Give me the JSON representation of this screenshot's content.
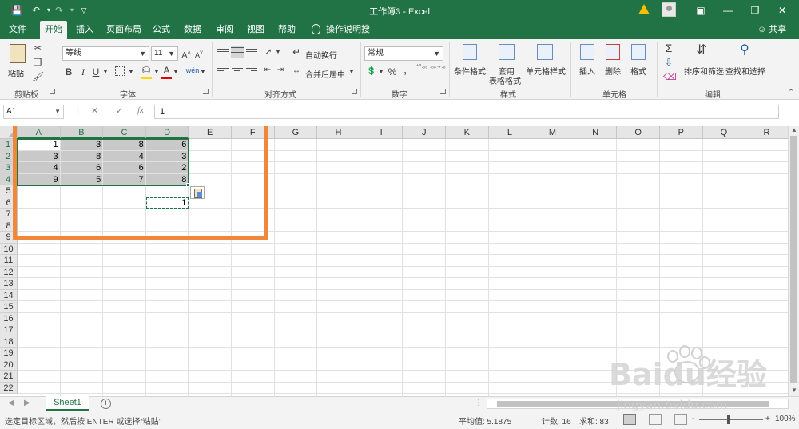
{
  "window": {
    "title": "工作簿3 - Excel",
    "undo_icon": "undo-icon",
    "redo_icon": "redo-icon",
    "save_icon": "save-icon"
  },
  "tabs": [
    {
      "label": "文件"
    },
    {
      "label": "开始",
      "active": true
    },
    {
      "label": "插入"
    },
    {
      "label": "页面布局"
    },
    {
      "label": "公式"
    },
    {
      "label": "数据"
    },
    {
      "label": "审阅"
    },
    {
      "label": "视图"
    },
    {
      "label": "帮助"
    },
    {
      "label": "操作说明搜索"
    }
  ],
  "share_label": "共享",
  "ribbon": {
    "clipboard": {
      "group_label": "剪贴板",
      "paste_label": "粘贴"
    },
    "font": {
      "group_label": "字体",
      "font_name": "等线",
      "font_size": "11",
      "bold": "B",
      "italic": "I",
      "underline": "U",
      "grow": "A",
      "shrink": "A",
      "wen": "wén"
    },
    "alignment": {
      "group_label": "对齐方式",
      "wrap_label": "自动换行",
      "merge_label": "合并后居中"
    },
    "number": {
      "group_label": "数字",
      "format": "常规",
      "percent": "%",
      "comma": ",",
      "inc_decimal": "⁺⁰.₀₀",
      "dec_decimal": ".₀₀→.₀"
    },
    "styles": {
      "group_label": "样式",
      "conditional": "条件格式",
      "table_fmt_1": "套用",
      "table_fmt_2": "表格格式",
      "cell_styles": "单元格样式"
    },
    "cells": {
      "group_label": "单元格",
      "insert": "插入",
      "delete": "删除",
      "format": "格式"
    },
    "editing": {
      "group_label": "编辑",
      "sort_filter": "排序和筛选",
      "find_select": "查找和选择"
    }
  },
  "formula_bar": {
    "name_box": "A1",
    "fx": "fx",
    "formula": "1"
  },
  "grid": {
    "columns": [
      "A",
      "B",
      "C",
      "D",
      "E",
      "F",
      "G",
      "H",
      "I",
      "J",
      "K",
      "L",
      "M",
      "N",
      "O",
      "P",
      "Q",
      "R"
    ],
    "selected_columns": [
      "A",
      "B",
      "C",
      "D"
    ],
    "rows": [
      "1",
      "2",
      "3",
      "4",
      "5",
      "6",
      "7",
      "8",
      "9",
      "10",
      "11",
      "12",
      "13",
      "14",
      "15",
      "16",
      "17",
      "18",
      "19",
      "20",
      "21",
      "22"
    ],
    "selected_rows": [
      "1",
      "2",
      "3",
      "4"
    ],
    "cells": [
      {
        "ref": "A1",
        "value": "1"
      },
      {
        "ref": "B1",
        "value": "3"
      },
      {
        "ref": "C1",
        "value": "8"
      },
      {
        "ref": "D1",
        "value": "6"
      },
      {
        "ref": "A2",
        "value": "3"
      },
      {
        "ref": "B2",
        "value": "8"
      },
      {
        "ref": "C2",
        "value": "4"
      },
      {
        "ref": "D2",
        "value": "3"
      },
      {
        "ref": "A3",
        "value": "4"
      },
      {
        "ref": "B3",
        "value": "6"
      },
      {
        "ref": "C3",
        "value": "6"
      },
      {
        "ref": "D3",
        "value": "2"
      },
      {
        "ref": "A4",
        "value": "9"
      },
      {
        "ref": "B4",
        "value": "5"
      },
      {
        "ref": "C4",
        "value": "7"
      },
      {
        "ref": "D4",
        "value": "8"
      },
      {
        "ref": "D6",
        "value": "1"
      }
    ],
    "selection": "A1:D4",
    "copy_marquee": "D6",
    "highlight_color": "#f0883a"
  },
  "sheets": [
    {
      "name": "Sheet1",
      "active": true
    }
  ],
  "status": {
    "message": "选定目标区域，然后按 ENTER 或选择“粘贴”",
    "average": "平均值: 5.1875",
    "count": "计数: 16",
    "sum": "求和: 83",
    "zoom": "100%",
    "zoom_minus": "-",
    "zoom_plus": "+"
  },
  "watermark": {
    "brand": "Baidu经验",
    "url": "jingyan.baidu.com"
  },
  "colors": {
    "accent": "#217346",
    "highlight": "#f0883a"
  }
}
